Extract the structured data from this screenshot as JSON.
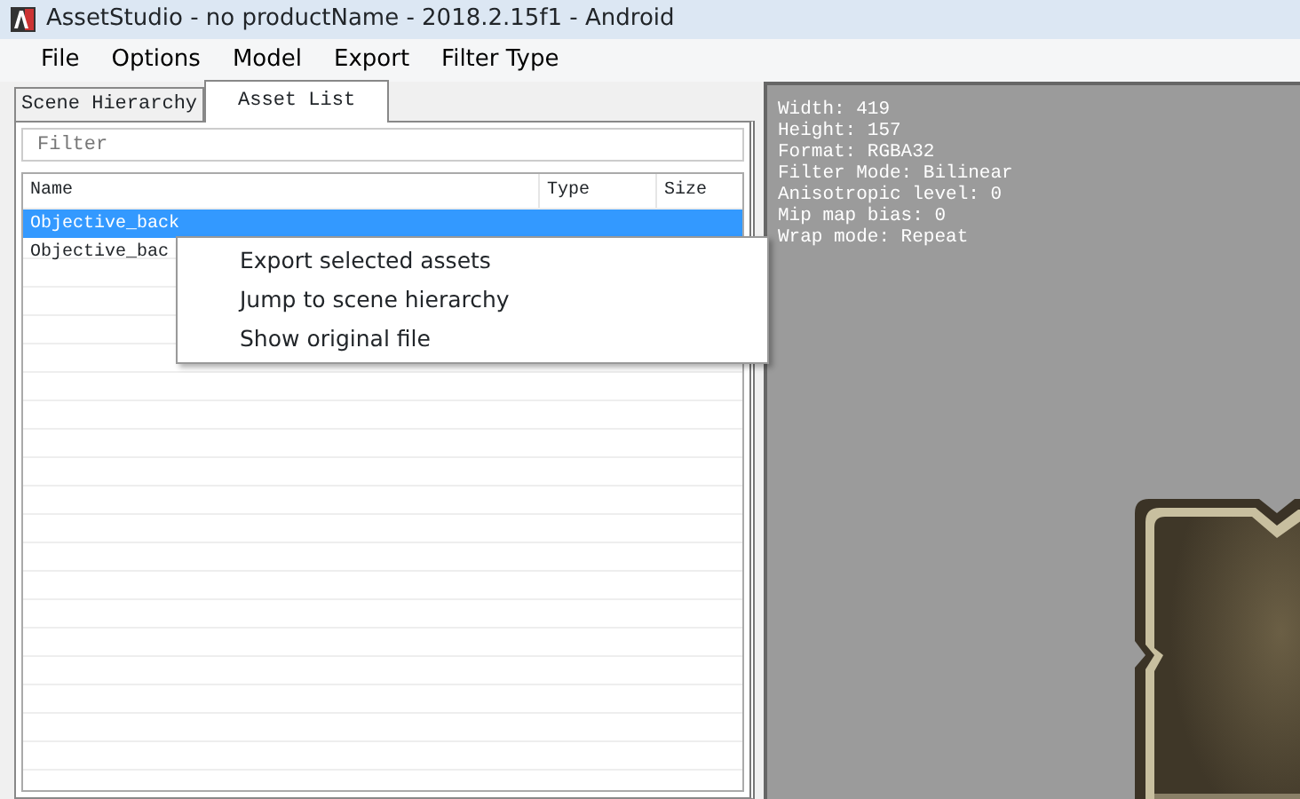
{
  "window": {
    "title": "AssetStudio - no productName - 2018.2.15f1 - Android"
  },
  "menu": [
    "File",
    "Options",
    "Model",
    "Export",
    "Filter Type"
  ],
  "tabs": [
    {
      "label": "Scene Hierarchy",
      "selected": false
    },
    {
      "label": "Asset List",
      "selected": true
    }
  ],
  "filter": {
    "placeholder": "Filter"
  },
  "table": {
    "columns": [
      "Name",
      "Type",
      "Size"
    ],
    "rows": [
      {
        "cells": [
          "Objective_back"
        ],
        "selected": true
      },
      {
        "cells": [
          "Objective_bac"
        ],
        "selected": false
      }
    ]
  },
  "context_menu": [
    "Export selected assets",
    "Jump to scene hierarchy",
    "Show original file"
  ],
  "preview": {
    "info": [
      "Width: 419",
      "Height: 157",
      "Format: RGBA32",
      "Filter Mode: Bilinear",
      "Anisotropic level: 0",
      "Mip map bias: 0",
      "Wrap mode: Repeat"
    ],
    "kind": "picture"
  }
}
